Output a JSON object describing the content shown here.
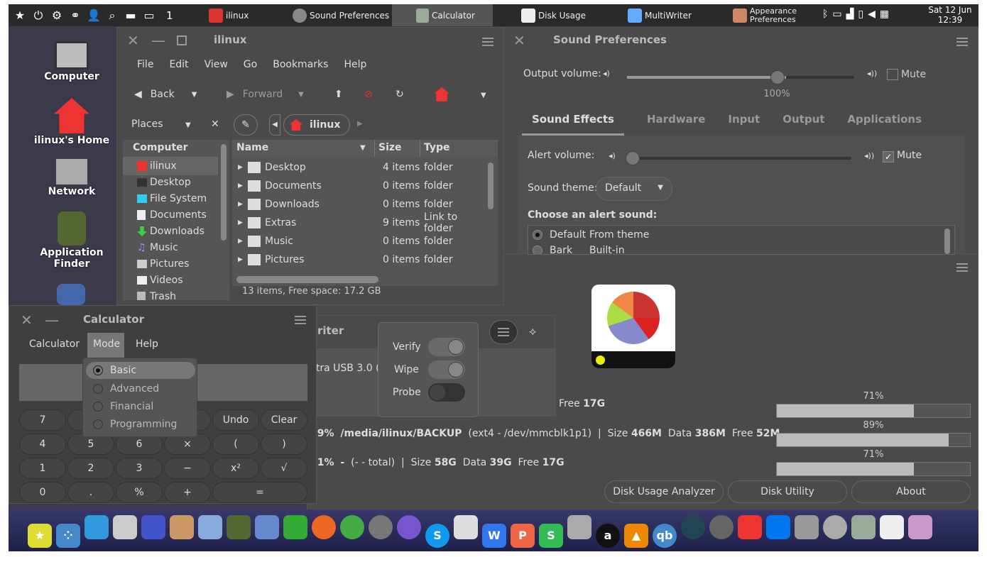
{
  "top_panel": {
    "workspace": "1",
    "clock_date": "Sat 12 Jun",
    "clock_time": "12:39",
    "tasks": [
      {
        "label": "ilinux"
      },
      {
        "label": "Sound Preferences"
      },
      {
        "label": "Calculator"
      },
      {
        "label": "Disk Usage"
      },
      {
        "label": "MultiWriter"
      },
      {
        "label": "Appearance Preferences"
      }
    ]
  },
  "desktop_icons": [
    {
      "label": "Computer"
    },
    {
      "label": "ilinux's Home"
    },
    {
      "label": "Network"
    },
    {
      "label": "Application Finder"
    }
  ],
  "file_manager": {
    "title": "ilinux",
    "menu": [
      "File",
      "Edit",
      "View",
      "Go",
      "Bookmarks",
      "Help"
    ],
    "back": "Back",
    "forward": "Forward",
    "places": "Places",
    "location": "ilinux",
    "sidebar_header": "Computer",
    "sidebar": [
      "ilinux",
      "Desktop",
      "File System",
      "Documents",
      "Downloads",
      "Music",
      "Pictures",
      "Videos",
      "Trash"
    ],
    "columns": {
      "name": "Name",
      "size": "Size",
      "type": "Type"
    },
    "rows": [
      {
        "name": "Desktop",
        "size": "4 items",
        "type": "folder"
      },
      {
        "name": "Documents",
        "size": "0 items",
        "type": "folder"
      },
      {
        "name": "Downloads",
        "size": "0 items",
        "type": "folder"
      },
      {
        "name": "Extras",
        "size": "9 items",
        "type": "Link to folder"
      },
      {
        "name": "Music",
        "size": "0 items",
        "type": "folder"
      },
      {
        "name": "Pictures",
        "size": "0 items",
        "type": "folder"
      }
    ],
    "status": "13 items, Free space: 17.2 GB"
  },
  "sound": {
    "title": "Sound Preferences",
    "output_label": "Output volume:",
    "mute": "Mute",
    "output_percent": "100%",
    "output_level": 0.7,
    "tabs": [
      "Sound Effects",
      "Hardware",
      "Input",
      "Output",
      "Applications"
    ],
    "alert_label": "Alert volume:",
    "alert_mute": "Mute",
    "alert_level": 0,
    "theme_label": "Sound theme:",
    "theme_value": "Default",
    "choose_label": "Choose an alert sound:",
    "sounds": [
      {
        "name": "Default",
        "from": "From theme"
      },
      {
        "name": "Bark",
        "from": "Built-in"
      }
    ]
  },
  "disk_usage": {
    "rows": [
      {
        "prefix": "",
        "text": "Free",
        "free": "17G",
        "percent": "71%",
        "level": 0.71
      },
      {
        "prefix": "89%",
        "mount": "/media/ilinux/BACKUP",
        "dev": "(ext4 - /dev/mmcblk1p1)",
        "size_l": "Size",
        "size": "466M",
        "data_l": "Data",
        "data": "386M",
        "free_l": "Free",
        "free": "52M",
        "percent": "89%",
        "level": 0.89
      },
      {
        "prefix": "71%",
        "mount": "-",
        "dev": "(- - total)",
        "size_l": "Size",
        "size": "58G",
        "data_l": "Data",
        "data": "39G",
        "free_l": "Free",
        "free": "17G",
        "percent": "71%",
        "level": 0.71
      }
    ],
    "buttons": [
      "Disk Usage Analyzer",
      "Disk Utility",
      "About"
    ]
  },
  "multiwriter": {
    "title_partial": "riter",
    "device_partial": "ltra USB 3.0 (",
    "popover": [
      {
        "label": "Verify",
        "on": true
      },
      {
        "label": "Wipe",
        "on": true
      },
      {
        "label": "Probe",
        "on": false
      }
    ]
  },
  "calculator": {
    "title": "Calculator",
    "menu": [
      "Calculator",
      "Mode",
      "Help"
    ],
    "mode_menu": [
      "Basic",
      "Advanced",
      "Financial",
      "Programming"
    ],
    "keys": [
      [
        "7",
        "",
        "",
        "",
        "Undo",
        "Clear"
      ],
      [
        "4",
        "5",
        "6",
        "×",
        "(",
        ")"
      ],
      [
        "1",
        "2",
        "3",
        "−",
        "x²",
        "√"
      ],
      [
        "0",
        ".",
        "%",
        "+",
        "="
      ]
    ]
  }
}
